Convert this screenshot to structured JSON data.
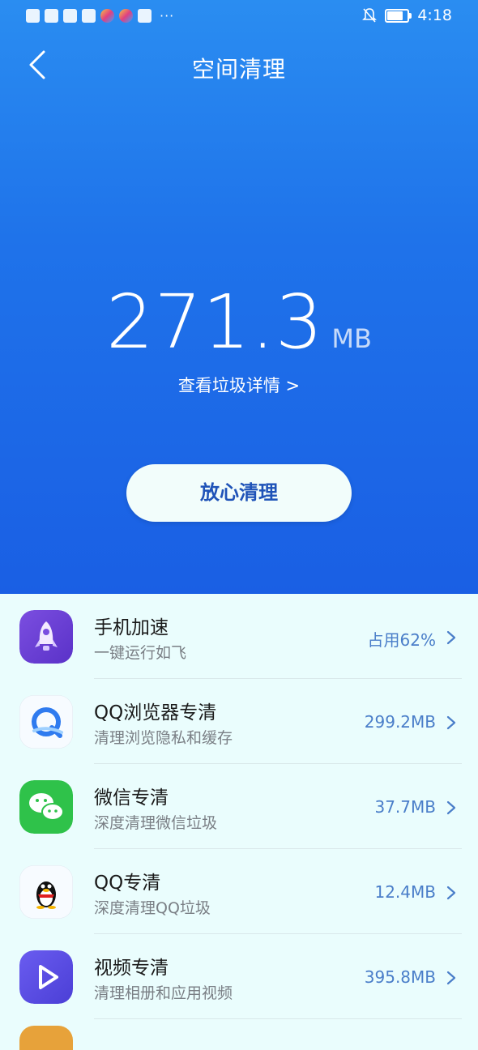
{
  "status_bar": {
    "time": "4:18",
    "more": "···"
  },
  "header": {
    "title": "空间清理"
  },
  "summary": {
    "size_value": "271.3",
    "size_unit": "MB",
    "detail_link": "查看垃圾详情 >"
  },
  "action": {
    "clean_label": "放心清理"
  },
  "items": [
    {
      "name": "手机加速",
      "desc": "一键运行如飞",
      "value": "占用62%",
      "icon": "rocket-icon"
    },
    {
      "name": "QQ浏览器专清",
      "desc": "清理浏览隐私和缓存",
      "value": "299.2MB",
      "icon": "qq-browser-icon"
    },
    {
      "name": "微信专清",
      "desc": "深度清理微信垃圾",
      "value": "37.7MB",
      "icon": "wechat-icon"
    },
    {
      "name": "QQ专清",
      "desc": "深度清理QQ垃圾",
      "value": "12.4MB",
      "icon": "qq-penguin-icon"
    },
    {
      "name": "视频专清",
      "desc": "清理相册和应用视频",
      "value": "395.8MB",
      "icon": "video-play-icon"
    }
  ],
  "colors": {
    "hero_top": "#2a8df1",
    "hero_bottom": "#1a5fe4",
    "list_bg": "#eafdfd",
    "value_text": "#4a7ec9"
  }
}
